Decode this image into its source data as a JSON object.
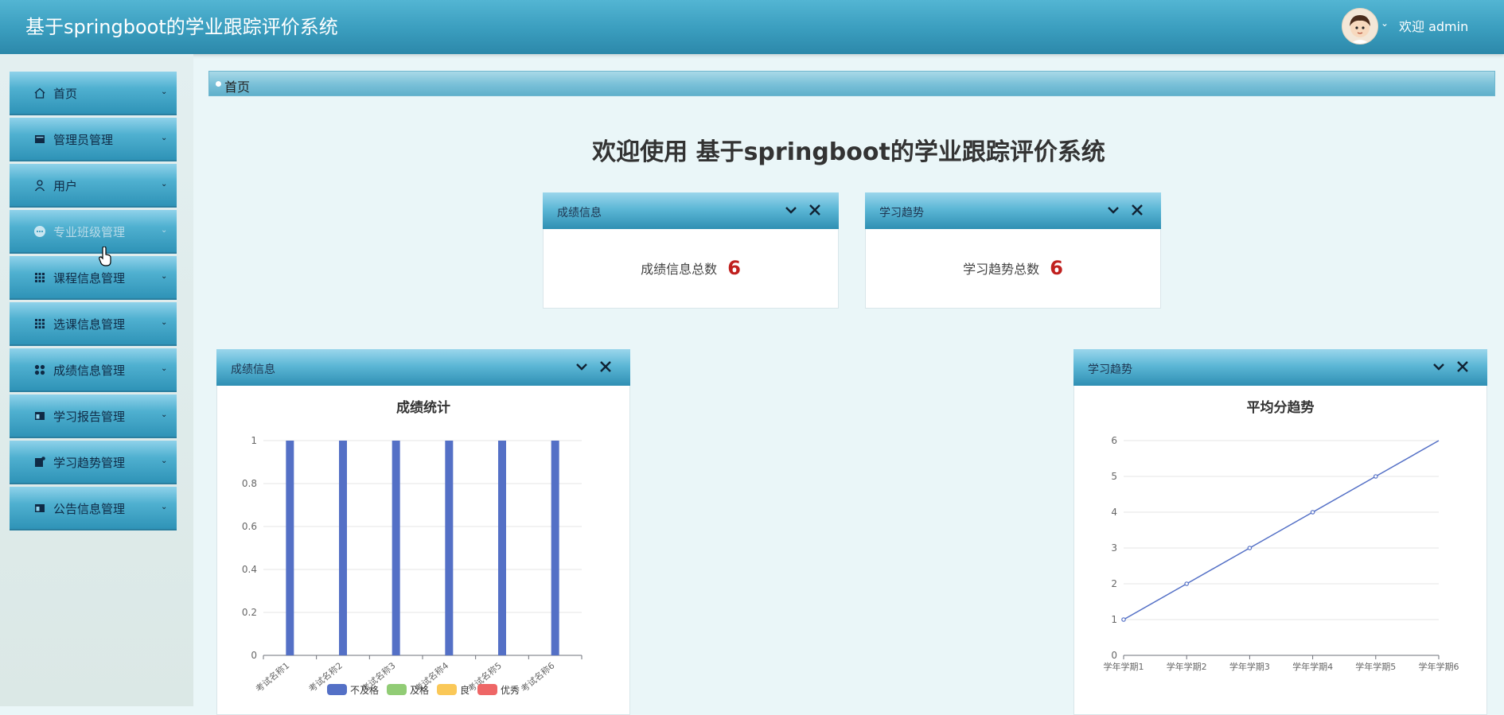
{
  "app": {
    "title": "基于springboot的学业跟踪评价系统"
  },
  "user": {
    "welcome": "欢迎 admin"
  },
  "sidebar": {
    "items": [
      {
        "label": "首页",
        "icon": "home-icon"
      },
      {
        "label": "管理员管理",
        "icon": "card-icon"
      },
      {
        "label": "用户",
        "icon": "user-icon"
      },
      {
        "label": "专业班级管理",
        "icon": "chat-dots-icon"
      },
      {
        "label": "课程信息管理",
        "icon": "grid-icon"
      },
      {
        "label": "选课信息管理",
        "icon": "grid-icon"
      },
      {
        "label": "成绩信息管理",
        "icon": "four-dots-icon"
      },
      {
        "label": "学习报告管理",
        "icon": "layout-icon"
      },
      {
        "label": "学习趋势管理",
        "icon": "note-icon"
      },
      {
        "label": "公告信息管理",
        "icon": "layout-icon"
      }
    ]
  },
  "breadcrumb": {
    "current": "首页"
  },
  "welcome": {
    "title": "欢迎使用 基于springboot的学业跟踪评价系统"
  },
  "stats": [
    {
      "panel_title": "成绩信息",
      "label": "成绩信息总数",
      "value": "6"
    },
    {
      "panel_title": "学习趋势",
      "label": "学习趋势总数",
      "value": "6"
    }
  ],
  "charts": {
    "grade": {
      "panel_title": "成绩信息"
    },
    "trend": {
      "panel_title": "学习趋势"
    }
  },
  "colors": {
    "accent": "#3a9dbe",
    "bar": "#5470c6",
    "stat_value": "#c0201e"
  },
  "chart_data": [
    {
      "type": "bar",
      "title": "成绩统计",
      "categories": [
        "考试名称1",
        "考试名称2",
        "考试名称3",
        "考试名称4",
        "考试名称5",
        "考试名称6"
      ],
      "series": [
        {
          "name": "不及格",
          "color": "#5470c6",
          "values": [
            1,
            1,
            1,
            1,
            1,
            1
          ]
        },
        {
          "name": "及格",
          "color": "#91cc75",
          "values": [
            0,
            0,
            0,
            0,
            0,
            0
          ]
        },
        {
          "name": "良",
          "color": "#fac858",
          "values": [
            0,
            0,
            0,
            0,
            0,
            0
          ]
        },
        {
          "name": "优秀",
          "color": "#ee6666",
          "values": [
            0,
            0,
            0,
            0,
            0,
            0
          ]
        }
      ],
      "ylim": [
        0,
        1
      ],
      "yticks": [
        "0",
        "0.2",
        "0.4",
        "0.6",
        "0.8",
        "1"
      ],
      "grid": true,
      "legend": "bottom"
    },
    {
      "type": "line",
      "title": "平均分趋势",
      "categories": [
        "学年学期1",
        "学年学期2",
        "学年学期3",
        "学年学期4",
        "学年学期5",
        "学年学期6"
      ],
      "values": [
        1,
        2,
        3,
        4,
        5,
        6
      ],
      "ylim": [
        0,
        6
      ],
      "yticks": [
        "0",
        "1",
        "2",
        "3",
        "4",
        "5",
        "6"
      ],
      "grid": true
    }
  ]
}
